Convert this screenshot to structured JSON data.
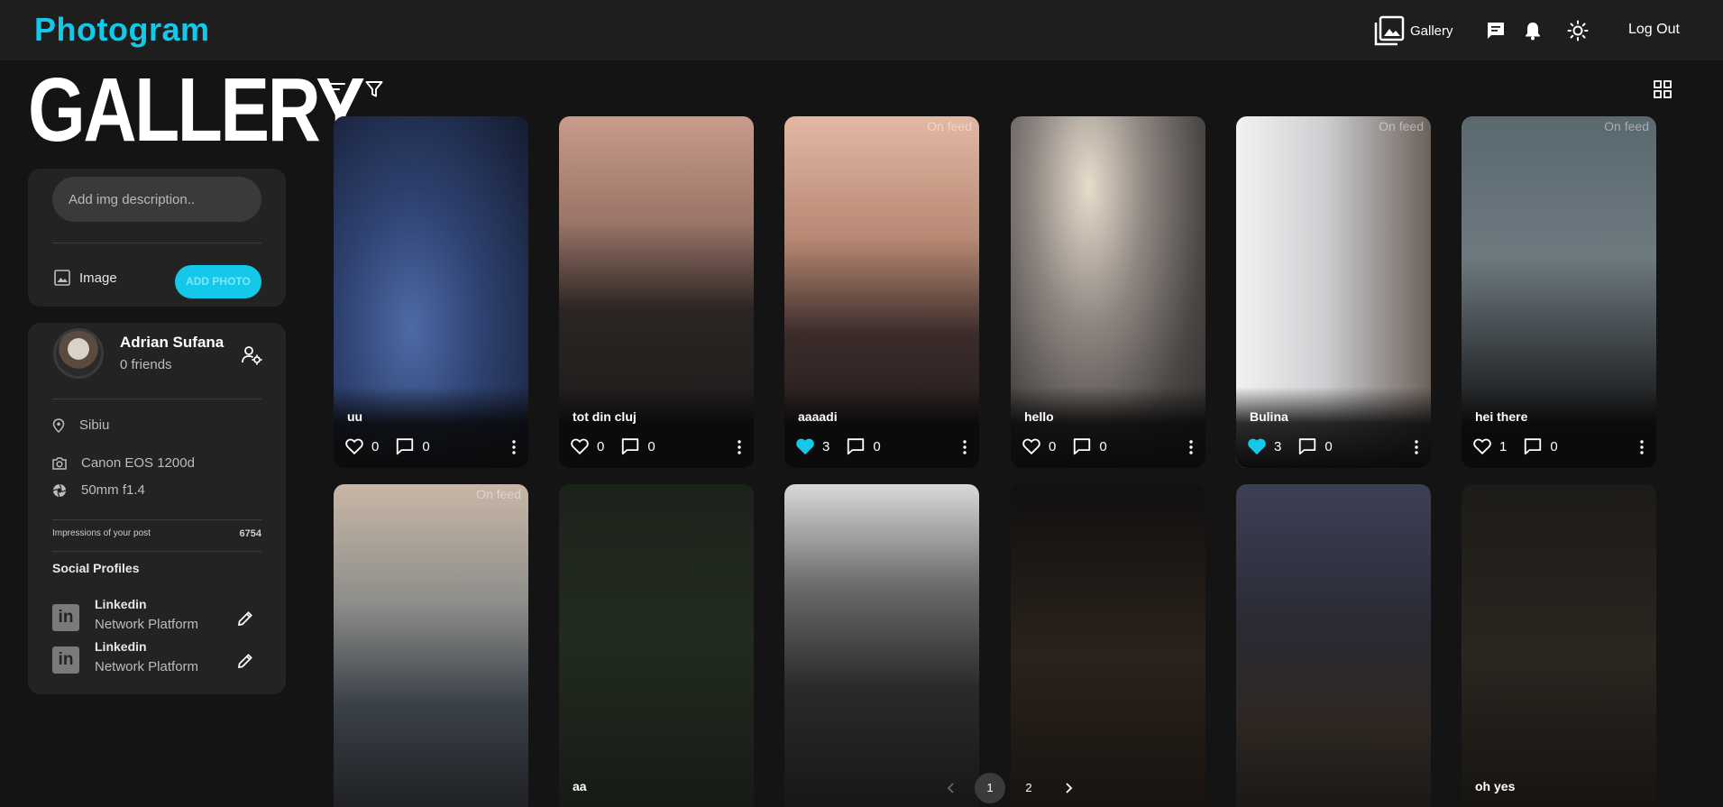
{
  "app": {
    "logo": "Photogram"
  },
  "nav": {
    "gallery_label": "Gallery",
    "logout_label": "Log Out"
  },
  "sidebar": {
    "title": "GALLERY",
    "upload": {
      "placeholder": "Add img description..",
      "image_label": "Image",
      "add_button": "ADD PHOTO"
    },
    "profile": {
      "name": "Adrian Sufana",
      "friends": "0 friends",
      "location": "Sibiu",
      "camera": "Canon EOS 1200d",
      "lens": "50mm f1.4",
      "impressions_label": "Impressions of your post",
      "impressions_value": "6754",
      "social_title": "Social Profiles",
      "socials": [
        {
          "name": "Linkedin",
          "sub": "Network Platform"
        },
        {
          "name": "Linkedin",
          "sub": "Network Platform"
        }
      ]
    }
  },
  "badge_text": "On feed",
  "photos": [
    {
      "title": "uu",
      "likes": "0",
      "comments": "0",
      "liked": false,
      "on_feed": false
    },
    {
      "title": "tot din cluj",
      "likes": "0",
      "comments": "0",
      "liked": false,
      "on_feed": false
    },
    {
      "title": "aaaadi",
      "likes": "3",
      "comments": "0",
      "liked": true,
      "on_feed": true
    },
    {
      "title": "hello",
      "likes": "0",
      "comments": "0",
      "liked": false,
      "on_feed": false
    },
    {
      "title": "Bulina",
      "likes": "3",
      "comments": "0",
      "liked": true,
      "on_feed": true
    },
    {
      "title": "hei there",
      "likes": "1",
      "comments": "0",
      "liked": false,
      "on_feed": true
    },
    {
      "title": "",
      "on_feed": true
    },
    {
      "title": "aa",
      "on_feed": false
    },
    {
      "title": "",
      "on_feed": false
    },
    {
      "title": "",
      "on_feed": false
    },
    {
      "title": "",
      "on_feed": false
    },
    {
      "title": "oh yes",
      "on_feed": false
    }
  ],
  "pagination": {
    "pages": [
      "1",
      "2"
    ],
    "current": "1"
  },
  "colors": {
    "accent": "#14c8ea",
    "liked": "#14c8ea"
  }
}
